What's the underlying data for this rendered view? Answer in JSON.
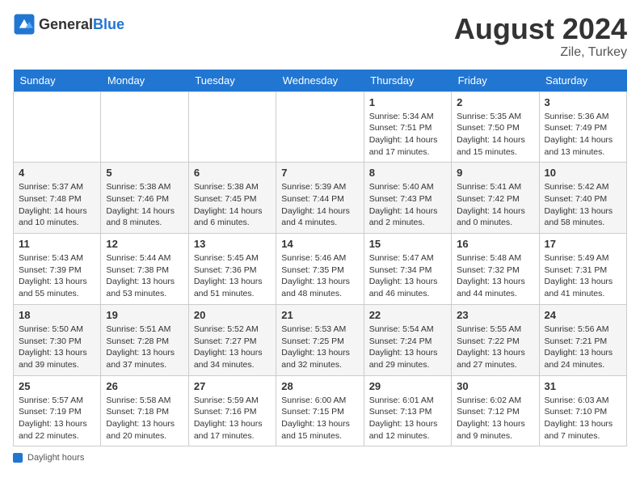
{
  "header": {
    "logo_general": "General",
    "logo_blue": "Blue",
    "month_year": "August 2024",
    "location": "Zile, Turkey"
  },
  "weekdays": [
    "Sunday",
    "Monday",
    "Tuesday",
    "Wednesday",
    "Thursday",
    "Friday",
    "Saturday"
  ],
  "weeks": [
    [
      {
        "day": "",
        "info": ""
      },
      {
        "day": "",
        "info": ""
      },
      {
        "day": "",
        "info": ""
      },
      {
        "day": "",
        "info": ""
      },
      {
        "day": "1",
        "info": "Sunrise: 5:34 AM\nSunset: 7:51 PM\nDaylight: 14 hours and 17 minutes."
      },
      {
        "day": "2",
        "info": "Sunrise: 5:35 AM\nSunset: 7:50 PM\nDaylight: 14 hours and 15 minutes."
      },
      {
        "day": "3",
        "info": "Sunrise: 5:36 AM\nSunset: 7:49 PM\nDaylight: 14 hours and 13 minutes."
      }
    ],
    [
      {
        "day": "4",
        "info": "Sunrise: 5:37 AM\nSunset: 7:48 PM\nDaylight: 14 hours and 10 minutes."
      },
      {
        "day": "5",
        "info": "Sunrise: 5:38 AM\nSunset: 7:46 PM\nDaylight: 14 hours and 8 minutes."
      },
      {
        "day": "6",
        "info": "Sunrise: 5:38 AM\nSunset: 7:45 PM\nDaylight: 14 hours and 6 minutes."
      },
      {
        "day": "7",
        "info": "Sunrise: 5:39 AM\nSunset: 7:44 PM\nDaylight: 14 hours and 4 minutes."
      },
      {
        "day": "8",
        "info": "Sunrise: 5:40 AM\nSunset: 7:43 PM\nDaylight: 14 hours and 2 minutes."
      },
      {
        "day": "9",
        "info": "Sunrise: 5:41 AM\nSunset: 7:42 PM\nDaylight: 14 hours and 0 minutes."
      },
      {
        "day": "10",
        "info": "Sunrise: 5:42 AM\nSunset: 7:40 PM\nDaylight: 13 hours and 58 minutes."
      }
    ],
    [
      {
        "day": "11",
        "info": "Sunrise: 5:43 AM\nSunset: 7:39 PM\nDaylight: 13 hours and 55 minutes."
      },
      {
        "day": "12",
        "info": "Sunrise: 5:44 AM\nSunset: 7:38 PM\nDaylight: 13 hours and 53 minutes."
      },
      {
        "day": "13",
        "info": "Sunrise: 5:45 AM\nSunset: 7:36 PM\nDaylight: 13 hours and 51 minutes."
      },
      {
        "day": "14",
        "info": "Sunrise: 5:46 AM\nSunset: 7:35 PM\nDaylight: 13 hours and 48 minutes."
      },
      {
        "day": "15",
        "info": "Sunrise: 5:47 AM\nSunset: 7:34 PM\nDaylight: 13 hours and 46 minutes."
      },
      {
        "day": "16",
        "info": "Sunrise: 5:48 AM\nSunset: 7:32 PM\nDaylight: 13 hours and 44 minutes."
      },
      {
        "day": "17",
        "info": "Sunrise: 5:49 AM\nSunset: 7:31 PM\nDaylight: 13 hours and 41 minutes."
      }
    ],
    [
      {
        "day": "18",
        "info": "Sunrise: 5:50 AM\nSunset: 7:30 PM\nDaylight: 13 hours and 39 minutes."
      },
      {
        "day": "19",
        "info": "Sunrise: 5:51 AM\nSunset: 7:28 PM\nDaylight: 13 hours and 37 minutes."
      },
      {
        "day": "20",
        "info": "Sunrise: 5:52 AM\nSunset: 7:27 PM\nDaylight: 13 hours and 34 minutes."
      },
      {
        "day": "21",
        "info": "Sunrise: 5:53 AM\nSunset: 7:25 PM\nDaylight: 13 hours and 32 minutes."
      },
      {
        "day": "22",
        "info": "Sunrise: 5:54 AM\nSunset: 7:24 PM\nDaylight: 13 hours and 29 minutes."
      },
      {
        "day": "23",
        "info": "Sunrise: 5:55 AM\nSunset: 7:22 PM\nDaylight: 13 hours and 27 minutes."
      },
      {
        "day": "24",
        "info": "Sunrise: 5:56 AM\nSunset: 7:21 PM\nDaylight: 13 hours and 24 minutes."
      }
    ],
    [
      {
        "day": "25",
        "info": "Sunrise: 5:57 AM\nSunset: 7:19 PM\nDaylight: 13 hours and 22 minutes."
      },
      {
        "day": "26",
        "info": "Sunrise: 5:58 AM\nSunset: 7:18 PM\nDaylight: 13 hours and 20 minutes."
      },
      {
        "day": "27",
        "info": "Sunrise: 5:59 AM\nSunset: 7:16 PM\nDaylight: 13 hours and 17 minutes."
      },
      {
        "day": "28",
        "info": "Sunrise: 6:00 AM\nSunset: 7:15 PM\nDaylight: 13 hours and 15 minutes."
      },
      {
        "day": "29",
        "info": "Sunrise: 6:01 AM\nSunset: 7:13 PM\nDaylight: 13 hours and 12 minutes."
      },
      {
        "day": "30",
        "info": "Sunrise: 6:02 AM\nSunset: 7:12 PM\nDaylight: 13 hours and 9 minutes."
      },
      {
        "day": "31",
        "info": "Sunrise: 6:03 AM\nSunset: 7:10 PM\nDaylight: 13 hours and 7 minutes."
      }
    ]
  ],
  "footer": {
    "label": "Daylight hours"
  }
}
